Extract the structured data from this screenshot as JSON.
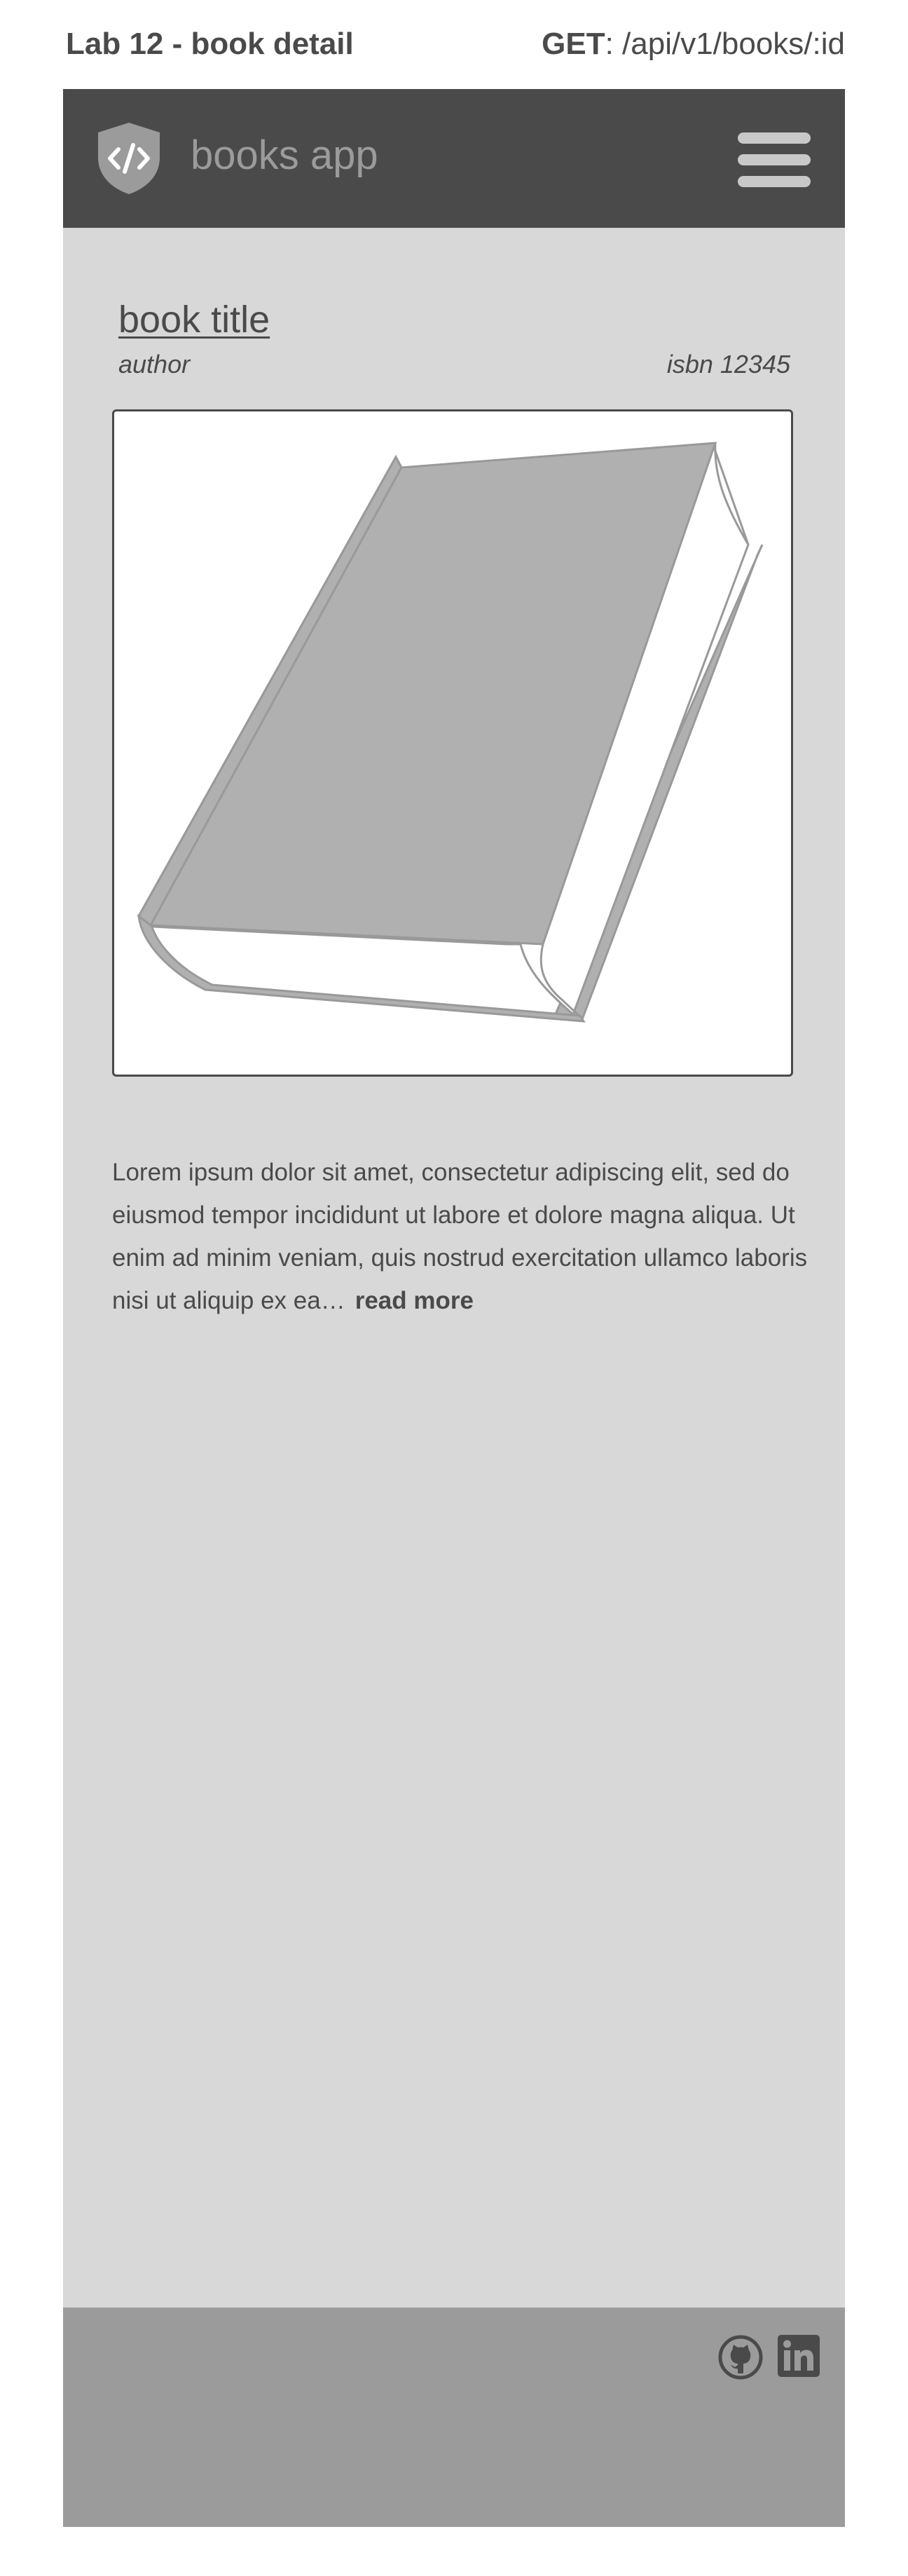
{
  "annotation": {
    "title": "Lab 12 - book detail",
    "method": "GET",
    "separator": ": ",
    "endpoint": "/api/v1/books/:id"
  },
  "header": {
    "logo_icon": "shield-code-icon",
    "app_name": "books app",
    "menu_icon": "hamburger-menu-icon"
  },
  "book": {
    "title": "book title",
    "author": "author",
    "isbn": "isbn 12345",
    "image_icon": "book-illustration",
    "description": "Lorem ipsum dolor sit amet, consectetur adipiscing elit, sed do eiusmod tempor incididunt ut labore et dolore magna aliqua. Ut enim ad minim veniam, quis nostrud exercitation ullamco laboris nisi ut aliquip ex ea…",
    "read_more": "read more"
  },
  "footer": {
    "icons": [
      "github-icon",
      "linkedin-icon"
    ]
  },
  "colors": {
    "annotation_text": "#4a4a4a",
    "header_bg": "#4a4a4a",
    "page_bg": "#d8d8d8",
    "footer_bg": "#9b9b9b",
    "app_name": "#9b9b9b",
    "menu_bars": "#c8c8c8",
    "cover": "#b0b0b0"
  }
}
